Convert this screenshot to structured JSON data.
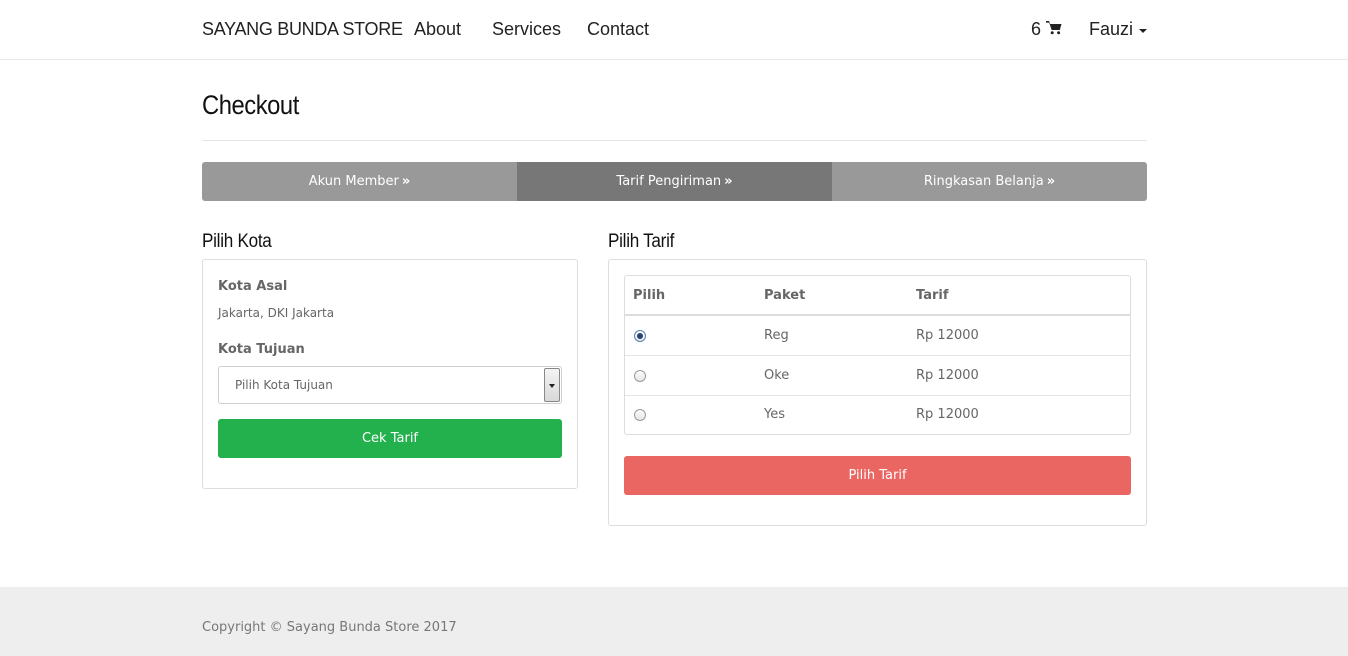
{
  "navbar": {
    "brand": "SAYANG BUNDA STORE",
    "links": [
      "About",
      "Services",
      "Contact"
    ],
    "cart_count": "6",
    "user_name": "Fauzi"
  },
  "page": {
    "title": "Checkout"
  },
  "steps": [
    {
      "label": "Akun Member",
      "active": false
    },
    {
      "label": "Tarif Pengiriman",
      "active": true
    },
    {
      "label": "Ringkasan Belanja",
      "active": false
    }
  ],
  "kota": {
    "section_title": "Pilih Kota",
    "asal_label": "Kota Asal",
    "asal_value": "Jakarta, DKI Jakarta",
    "tujuan_label": "Kota Tujuan",
    "tujuan_selected": "Pilih Kota Tujuan",
    "cek_button": "Cek Tarif"
  },
  "tarif": {
    "section_title": "Pilih Tarif",
    "columns": [
      "Pilih",
      "Paket",
      "Tarif"
    ],
    "rows": [
      {
        "paket": "Reg",
        "tarif": "Rp 12000",
        "selected": true
      },
      {
        "paket": "Oke",
        "tarif": "Rp 12000",
        "selected": false
      },
      {
        "paket": "Yes",
        "tarif": "Rp 12000",
        "selected": false
      }
    ],
    "pilih_button": "Pilih Tarif"
  },
  "footer": {
    "copyright": "Copyright © Sayang Bunda Store 2017"
  },
  "colors": {
    "step_inactive": "#999999",
    "step_active": "#777777",
    "btn_success": "#22b14c",
    "btn_danger": "#ea6662",
    "footer_bg": "#eeeeee"
  }
}
